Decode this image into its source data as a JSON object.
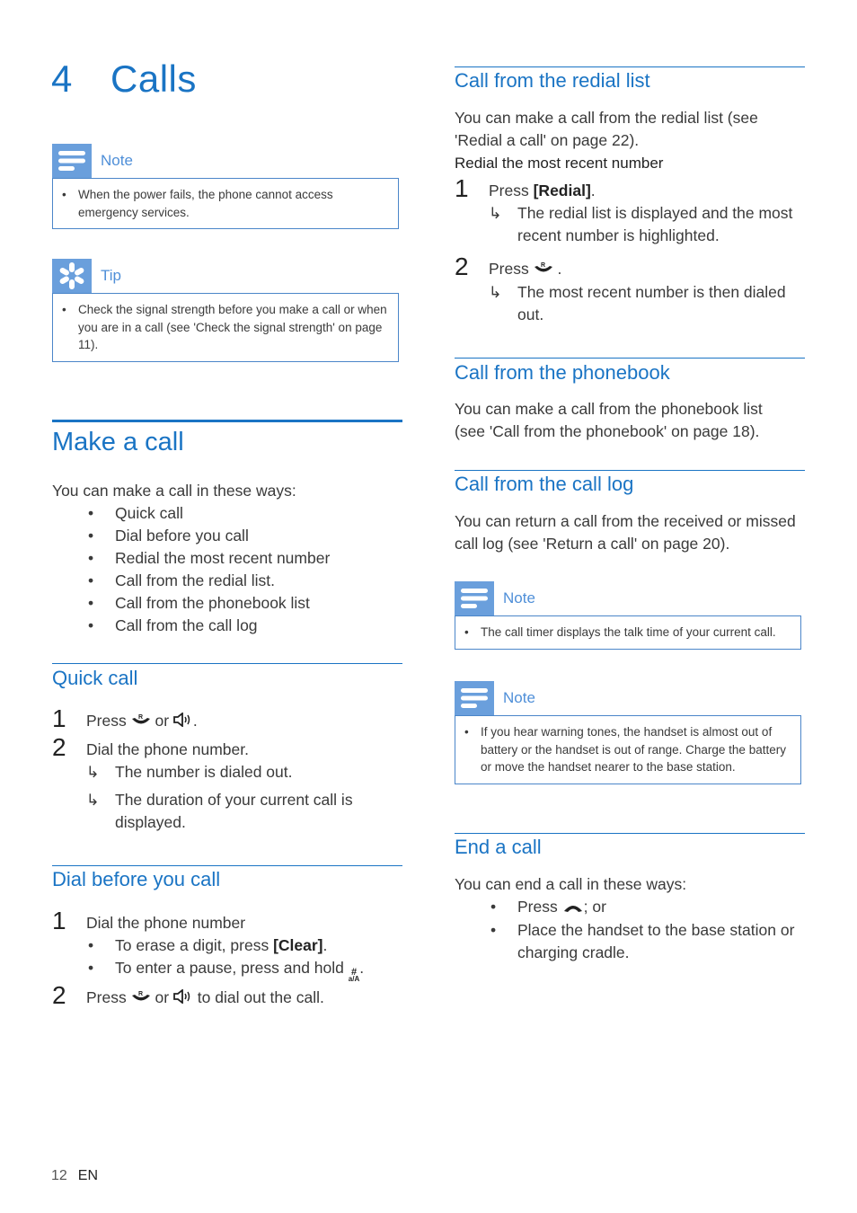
{
  "chapter": {
    "number": "4",
    "title": "Calls"
  },
  "left_notes": [
    {
      "type": "Note",
      "icon": "note-icon",
      "items": [
        "When the power fails, the phone cannot access emergency services."
      ]
    },
    {
      "type": "Tip",
      "icon": "tip-icon",
      "items": [
        "Check the signal strength before you make a call or when you are in a call (see 'Check the signal strength' on page 11)."
      ]
    }
  ],
  "make_a_call": {
    "title": "Make a call",
    "intro": "You can make a call in these ways:",
    "ways": [
      "Quick call",
      "Dial before you call",
      "Redial the most recent number",
      "Call from the redial list.",
      "Call from the phonebook list",
      "Call from the call log"
    ]
  },
  "quick_call": {
    "title": "Quick call",
    "step1": {
      "num": "1",
      "press": "Press",
      "or": "or",
      "end": "."
    },
    "step2": {
      "num": "2",
      "text": "Dial the phone number.",
      "results": [
        "The number is dialed out.",
        "The duration of your current call is displayed."
      ]
    }
  },
  "dial_before": {
    "title": "Dial before you call",
    "step1": {
      "num": "1",
      "text": "Dial the phone number",
      "sub1": {
        "pre": "To erase a digit, press",
        "key": "[Clear]",
        "post": "."
      },
      "sub2": {
        "pre": "To enter a pause, press and hold",
        "key_top": "#",
        "key_bottom": "a/A",
        "post": "."
      }
    },
    "step2": {
      "num": "2",
      "press": "Press",
      "or": "or",
      "post": "to dial out the call."
    }
  },
  "redial": {
    "title": "Call from the redial list",
    "intro": "You can make a call from the redial list (see 'Redial a call' on page 22).",
    "subheading": "Redial the most recent number",
    "step1": {
      "num": "1",
      "press": "Press",
      "key": "[Redial]",
      "end": ".",
      "result": "The redial list is displayed and the most recent number is highlighted."
    },
    "step2": {
      "num": "2",
      "press": "Press",
      "end": ".",
      "result": "The most recent number is then dialed out."
    }
  },
  "phonebook": {
    "title": "Call from the phonebook",
    "text": "You can make a call from the phonebook list (see 'Call from the phonebook' on page 18)."
  },
  "call_log": {
    "title": "Call from the call log",
    "text": "You can return a call from the received or missed call log (see 'Return a call' on page 20)."
  },
  "right_notes": [
    {
      "type": "Note",
      "items": [
        "The call timer displays the talk time of your current call."
      ]
    },
    {
      "type": "Note",
      "items": [
        "If you hear warning tones, the handset is almost out of battery or the handset is out of range. Charge the battery or move the handset nearer to the base station."
      ]
    }
  ],
  "end_call": {
    "title": "End a call",
    "intro": "You can end a call in these ways:",
    "way1": {
      "press": "Press",
      "post": "; or"
    },
    "way2": "Place the handset to the base station or charging cradle."
  },
  "footer": {
    "page": "12",
    "lang": "EN"
  },
  "colors": {
    "accent": "#1a74c4",
    "note_icon_bg": "#6a9fdc",
    "note_border": "#4b86c9",
    "body_text": "#3a3a3a"
  }
}
